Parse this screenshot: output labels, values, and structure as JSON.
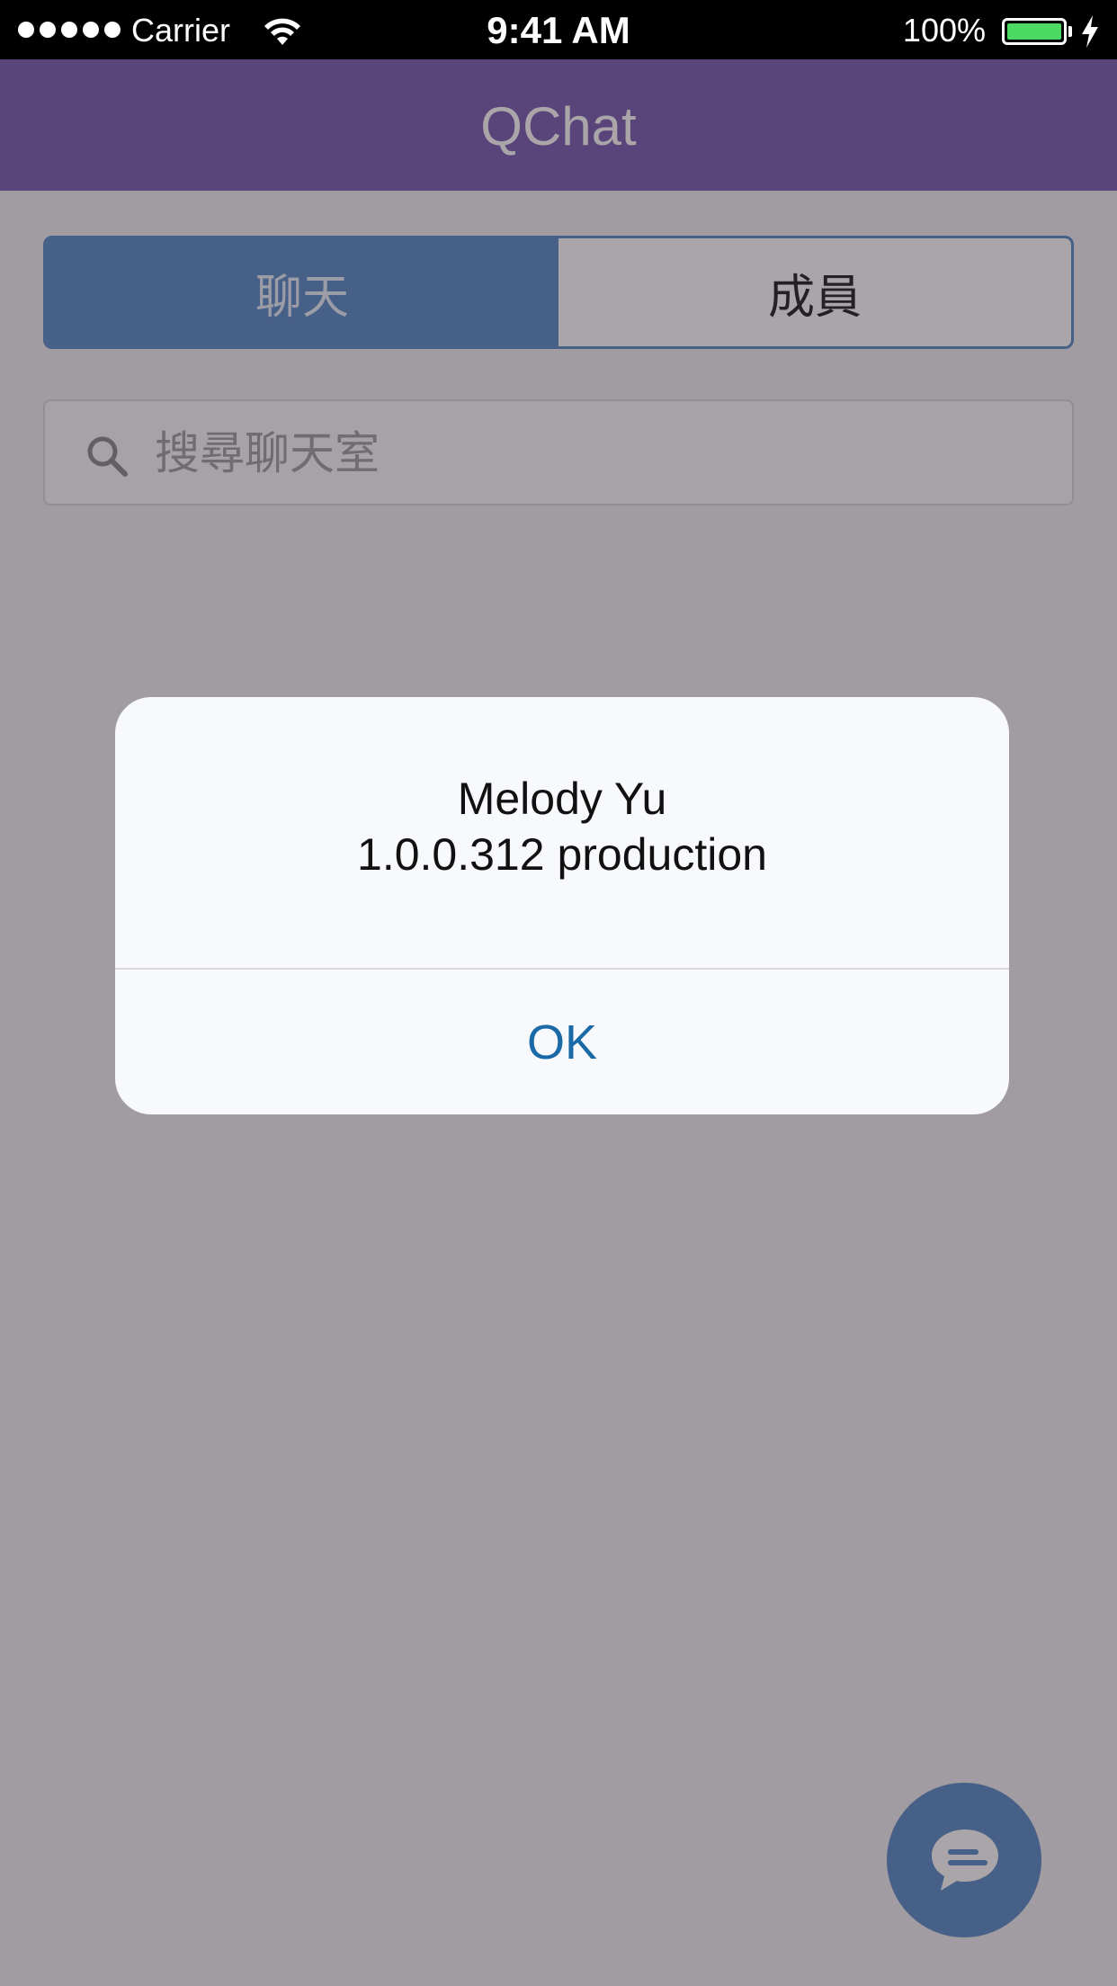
{
  "status_bar": {
    "carrier": "Carrier",
    "time": "9:41 AM",
    "battery_percent": "100%",
    "battery_level": 1.0
  },
  "header": {
    "title": "QChat"
  },
  "tabs": [
    {
      "label": "聊天",
      "selected": true
    },
    {
      "label": "成員",
      "selected": false
    }
  ],
  "search": {
    "placeholder": "搜尋聊天室"
  },
  "alert": {
    "name": "Melody Yu",
    "version": "1.0.0.312 production",
    "ok_label": "OK"
  },
  "colors": {
    "header": "#7b5fb0",
    "accent": "#5a8dc6",
    "alert_button": "#1a6aa8",
    "battery": "#4cd964"
  },
  "icons": {
    "signal": "signal-dots-icon",
    "wifi": "wifi-icon",
    "battery": "battery-icon",
    "charging": "charging-bolt-icon",
    "search": "search-icon",
    "chat": "chat-bubble-icon"
  }
}
